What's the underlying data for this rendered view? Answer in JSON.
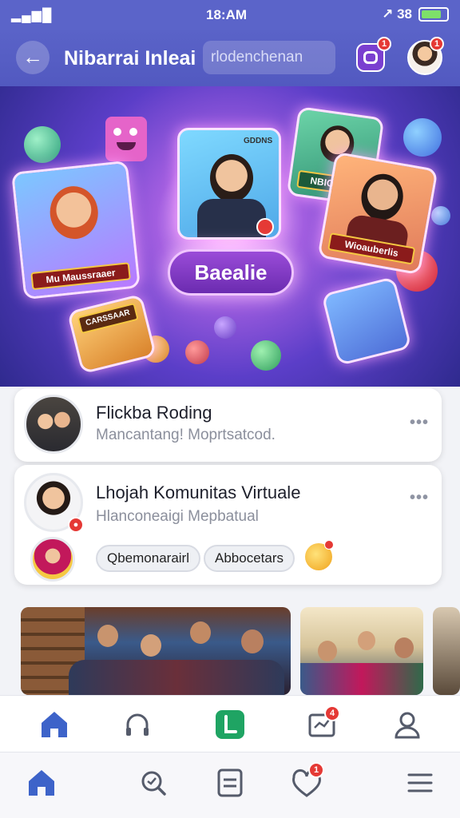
{
  "status_bar": {
    "signal": "▂▄▆█",
    "time": "18:AM",
    "right_text": "↗ 38",
    "battery_level": 0.7
  },
  "header": {
    "title": "Nibarrai Inleai",
    "search_placeholder": "rlodenchenan",
    "message_badge": "1",
    "avatar_badge": "1"
  },
  "hero": {
    "button_label": "Baealie",
    "card_labels": [
      "Mu Maussraaer",
      "NBIOSEE",
      "Wioauberlis",
      "CARSSAAR"
    ],
    "card_top_label": "GDDNS"
  },
  "items": [
    {
      "title": "Flickba Roding",
      "subtitle": "Mancantang! Moprtsatcod.",
      "more": "•••"
    },
    {
      "title": "Lhojah Komunitas Virtuale",
      "subtitle": "Hlanconeaigi Mepbatual",
      "more": "•••",
      "chips": [
        "Qbemonarairl",
        "Abbocetars"
      ]
    }
  ],
  "nav_top": {
    "items": [
      "home-icon",
      "headset-icon",
      "play-icon",
      "calendar-icon",
      "profile-icon"
    ],
    "calendar_badge": "4"
  },
  "nav_bottom": {
    "items": [
      "home-icon",
      "search-icon",
      "list-icon",
      "heart-icon",
      "menu-icon"
    ],
    "heart_badge": "1"
  },
  "colors": {
    "accent": "#5b64c9",
    "badge": "#e53935",
    "nav_active": "#3d63c9",
    "play": "#1fa463"
  }
}
